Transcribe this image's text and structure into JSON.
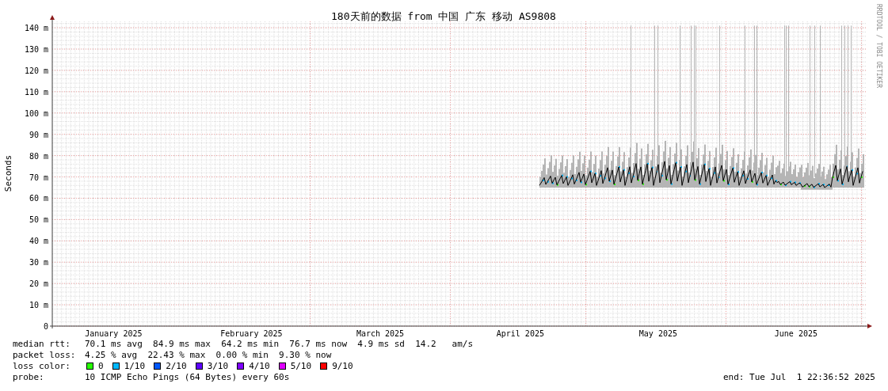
{
  "graph": {
    "title": "180天前的数据 from 中国 广东 移动 AS9808",
    "watermark": "RRDTOOL / TOBI OETIKER",
    "y_axis_label": "Seconds",
    "y_ticks": [
      "140 m",
      "130 m",
      "120 m",
      "110 m",
      "100 m",
      "90 m",
      "80 m",
      "70 m",
      "60 m",
      "50 m",
      "40 m",
      "30 m",
      "20 m",
      "10 m",
      "0"
    ],
    "x_labels": [
      "January 2025",
      "February 2025",
      "March 2025",
      "April 2025",
      "May 2025",
      "June 2025"
    ]
  },
  "stats": [
    {
      "label": "median rtt:",
      "text": "70.1 ms avg  84.9 ms max  64.2 ms min  76.7 ms now  4.9 ms sd  14.2   am/s"
    },
    {
      "label": "packet loss:",
      "text": "4.25 % avg  22.43 % max  0.00 % min  9.30 % now"
    }
  ],
  "loss_color": {
    "label": "loss color:",
    "items": [
      {
        "text": "0",
        "color": "#26ff00"
      },
      {
        "text": "1/10",
        "color": "#00b8ff"
      },
      {
        "text": "2/10",
        "color": "#0059ff"
      },
      {
        "text": "3/10",
        "color": "#5e00ff"
      },
      {
        "text": "4/10",
        "color": "#7e00ff"
      },
      {
        "text": "5/10",
        "color": "#dd00ff"
      },
      {
        "text": "9/10",
        "color": "#ff0000"
      }
    ]
  },
  "probe": {
    "label": "probe:",
    "text": "10 ICMP Echo Pings (64 Bytes) every 60s"
  },
  "end": "end: Tue Jul  1 22:36:52 2025"
}
